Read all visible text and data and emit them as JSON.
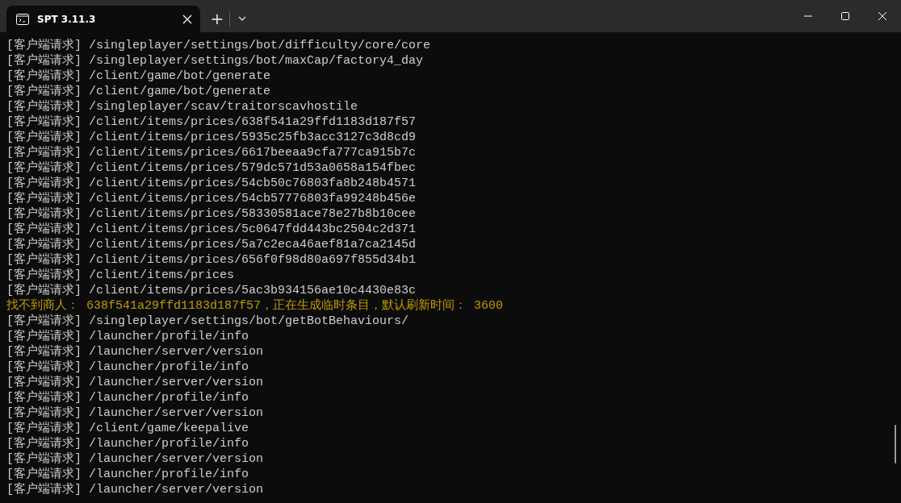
{
  "window": {
    "tab": {
      "title": "SPT 3.11.3",
      "selected": true
    },
    "new_tab": "+"
  },
  "console": {
    "lines": [
      {
        "kind": "request",
        "text": "[客户端请求] /singleplayer/settings/bot/difficulty/core/core"
      },
      {
        "kind": "request",
        "text": "[客户端请求] /singleplayer/settings/bot/maxCap/factory4_day"
      },
      {
        "kind": "request",
        "text": "[客户端请求] /client/game/bot/generate"
      },
      {
        "kind": "request",
        "text": "[客户端请求] /client/game/bot/generate"
      },
      {
        "kind": "request",
        "text": "[客户端请求] /singleplayer/scav/traitorscavhostile"
      },
      {
        "kind": "request",
        "text": "[客户端请求] /client/items/prices/638f541a29ffd1183d187f57"
      },
      {
        "kind": "request",
        "text": "[客户端请求] /client/items/prices/5935c25fb3acc3127c3d8cd9"
      },
      {
        "kind": "request",
        "text": "[客户端请求] /client/items/prices/6617beeaa9cfa777ca915b7c"
      },
      {
        "kind": "request",
        "text": "[客户端请求] /client/items/prices/579dc571d53a0658a154fbec"
      },
      {
        "kind": "request",
        "text": "[客户端请求] /client/items/prices/54cb50c76803fa8b248b4571"
      },
      {
        "kind": "request",
        "text": "[客户端请求] /client/items/prices/54cb57776803fa99248b456e"
      },
      {
        "kind": "request",
        "text": "[客户端请求] /client/items/prices/58330581ace78e27b8b10cee"
      },
      {
        "kind": "request",
        "text": "[客户端请求] /client/items/prices/5c0647fdd443bc2504c2d371"
      },
      {
        "kind": "request",
        "text": "[客户端请求] /client/items/prices/5a7c2eca46aef81a7ca2145d"
      },
      {
        "kind": "request",
        "text": "[客户端请求] /client/items/prices/656f0f98d80a697f855d34b1"
      },
      {
        "kind": "request",
        "text": "[客户端请求] /client/items/prices"
      },
      {
        "kind": "request",
        "text": "[客户端请求] /client/items/prices/5ac3b934156ae10c4430e83c"
      },
      {
        "kind": "warning",
        "text": "找不到商人： 638f541a29ffd1183d187f57，正在生成临时条目，默认刷新时间： 3600"
      },
      {
        "kind": "request",
        "text": "[客户端请求] /singleplayer/settings/bot/getBotBehaviours/"
      },
      {
        "kind": "request",
        "text": "[客户端请求] /launcher/profile/info"
      },
      {
        "kind": "request",
        "text": "[客户端请求] /launcher/server/version"
      },
      {
        "kind": "request",
        "text": "[客户端请求] /launcher/profile/info"
      },
      {
        "kind": "request",
        "text": "[客户端请求] /launcher/server/version"
      },
      {
        "kind": "request",
        "text": "[客户端请求] /launcher/profile/info"
      },
      {
        "kind": "request",
        "text": "[客户端请求] /launcher/server/version"
      },
      {
        "kind": "request",
        "text": "[客户端请求] /client/game/keepalive"
      },
      {
        "kind": "request",
        "text": "[客户端请求] /launcher/profile/info"
      },
      {
        "kind": "request",
        "text": "[客户端请求] /launcher/server/version"
      },
      {
        "kind": "request",
        "text": "[客户端请求] /launcher/profile/info"
      },
      {
        "kind": "request",
        "text": "[客户端请求] /launcher/server/version"
      }
    ]
  }
}
